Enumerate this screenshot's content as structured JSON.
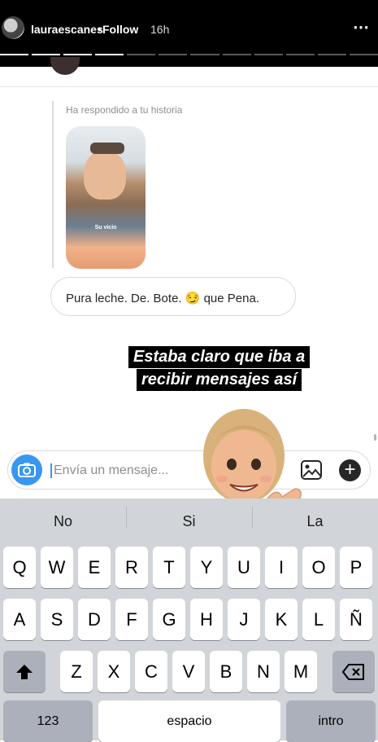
{
  "story": {
    "username": "lauraescanes",
    "separator": "•",
    "follow_label": "Follow",
    "time": "16h",
    "more_icon": "⋯"
  },
  "chat": {
    "reply_label": "Ha respondido a tu historia",
    "story_caption": "Su vicio",
    "message": "Pura leche. De. Bote. 😏 que Pena."
  },
  "overlay": {
    "line1": "Estaba claro que iba a",
    "line2": "recibir mensajes así"
  },
  "compose": {
    "placeholder": "Envía un mensaje..."
  },
  "keyboard": {
    "suggestions": [
      "No",
      "Si",
      "La"
    ],
    "row1": [
      "Q",
      "W",
      "E",
      "R",
      "T",
      "Y",
      "U",
      "I",
      "O",
      "P"
    ],
    "row2": [
      "A",
      "S",
      "D",
      "F",
      "G",
      "H",
      "J",
      "K",
      "L",
      "Ñ"
    ],
    "row3": [
      "Z",
      "X",
      "C",
      "V",
      "B",
      "N",
      "M"
    ],
    "numbers_label": "123",
    "space_label": "espacio",
    "return_label": "intro"
  },
  "colors": {
    "accent": "#3897f0",
    "keyboard_bg": "#d1d4d9",
    "special_key": "#abb0bb"
  }
}
